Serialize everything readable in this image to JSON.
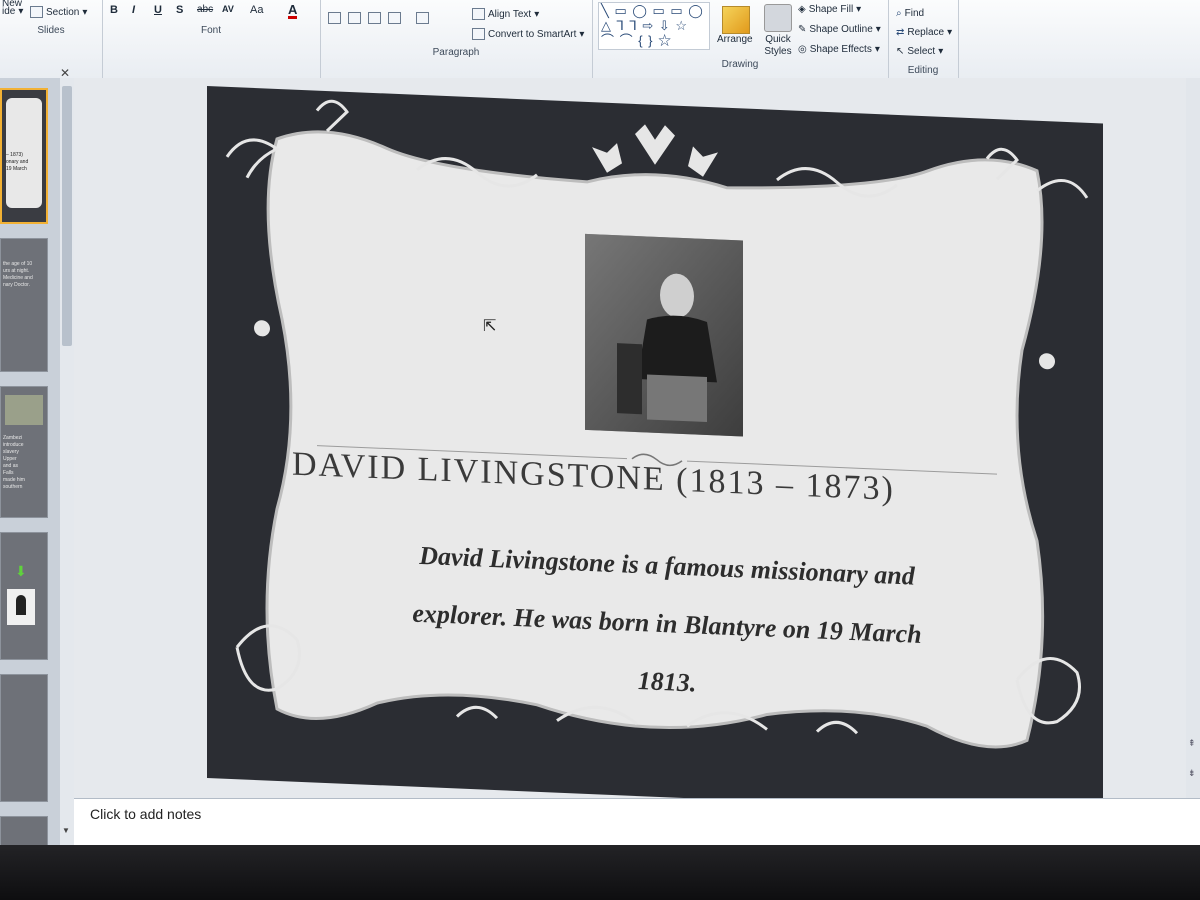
{
  "ribbon": {
    "slides_group": {
      "new_label": "New",
      "layout_label": "ide",
      "section_label": "Section",
      "group_label": "Slides"
    },
    "font_group": {
      "bold": "B",
      "italic": "I",
      "underline": "U",
      "shadow": "S",
      "strikethrough": "abc",
      "spacing": "AV",
      "change_case": "Aa",
      "font_color": "A",
      "group_label": "Font"
    },
    "paragraph_group": {
      "align_text": "Align Text",
      "convert_smartart": "Convert to SmartArt",
      "group_label": "Paragraph"
    },
    "drawing_group": {
      "shape_glyphs_row1": "╲ ▭ ◯ ▭ ▭ ◯",
      "shape_glyphs_row2": "△ ⅂ ⅂ ⇨ ⇩ ☆",
      "shape_glyphs_row3": "⌒ ⌒ { } ☆",
      "arrange": "Arrange",
      "quick_styles": "Quick Styles",
      "shape_fill": "Shape Fill",
      "shape_outline": "Shape Outline",
      "shape_effects": "Shape Effects",
      "group_label": "Drawing"
    },
    "editing_group": {
      "find": "Find",
      "replace": "Replace",
      "select": "Select",
      "group_label": "Editing"
    }
  },
  "thumbnails": [
    {
      "text": "– 1873)\nonary and\n19 March"
    },
    {
      "text": "the age of 10\nurs at night.\nMedicine and\nnary Doctor."
    },
    {
      "text": "Zambezi\nintroduce\nslavery\nUpper\nand as\nFalls\nmade him\nsouthern"
    },
    {
      "text": ""
    },
    {
      "text": ""
    }
  ],
  "slide": {
    "title": "DAVID LIVINGSTONE (1813 – 1873)",
    "body_line1": "David Livingstone is a famous missionary and",
    "body_line2": "explorer.  He was born in Blantyre on 19 March",
    "body_line3": "1813."
  },
  "notes": {
    "placeholder": "Click to add notes"
  }
}
